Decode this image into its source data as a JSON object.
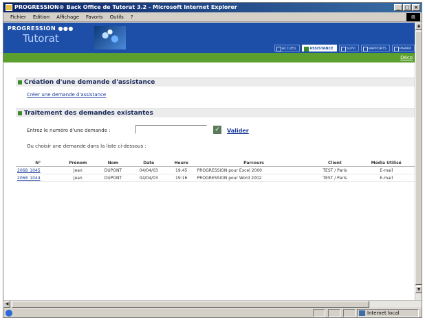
{
  "window": {
    "title": "PROGRESSION® Back Office de Tutorat 3.2 - Microsoft Internet Explorer"
  },
  "menubar": [
    "Fichier",
    "Edition",
    "Affichage",
    "Favoris",
    "Outils",
    "?"
  ],
  "banner": {
    "logo_top": "PROGRESSION ●●●",
    "logo_main": "Tutorat",
    "tabs": [
      "ACCUEIL",
      "ASSISTANCE",
      "SUIVI",
      "RAPPORTS",
      "PARAM"
    ],
    "active_tab": "ASSISTANCE",
    "deconnexion": "Déco"
  },
  "creation": {
    "title": "Création d'une demande d'assistance",
    "link": "Créer une demande d'assistance"
  },
  "traitement": {
    "title": "Traitement des demandes existantes",
    "input_label": "Entrez le numéro d'une demande :",
    "input_value": "",
    "valider": "Valider",
    "hint": "Ou choisir une demande dans la liste ci-dessous :"
  },
  "table": {
    "headers": [
      "N°",
      "Prénom",
      "Nom",
      "Date",
      "Heure",
      "Parcours",
      "Client",
      "Média Utilisé"
    ],
    "rows": [
      [
        "2068_1045",
        "Jean",
        "DUPONT",
        "04/04/03",
        "19:45",
        "PROGRESSION pour Excel 2000",
        "TEST / Paris",
        "E-mail"
      ],
      [
        "2068_1044",
        "Jean",
        "DUPONT",
        "04/04/03",
        "19:16",
        "PROGRESSION pour Word 2002",
        "TEST / Paris",
        "E-mail"
      ]
    ]
  },
  "statusbar": {
    "zone": "Internet local"
  },
  "colors": {
    "banner_blue": "#1e4fa8",
    "green_bar": "#5ba02f",
    "link_blue": "#1a3a9a"
  }
}
